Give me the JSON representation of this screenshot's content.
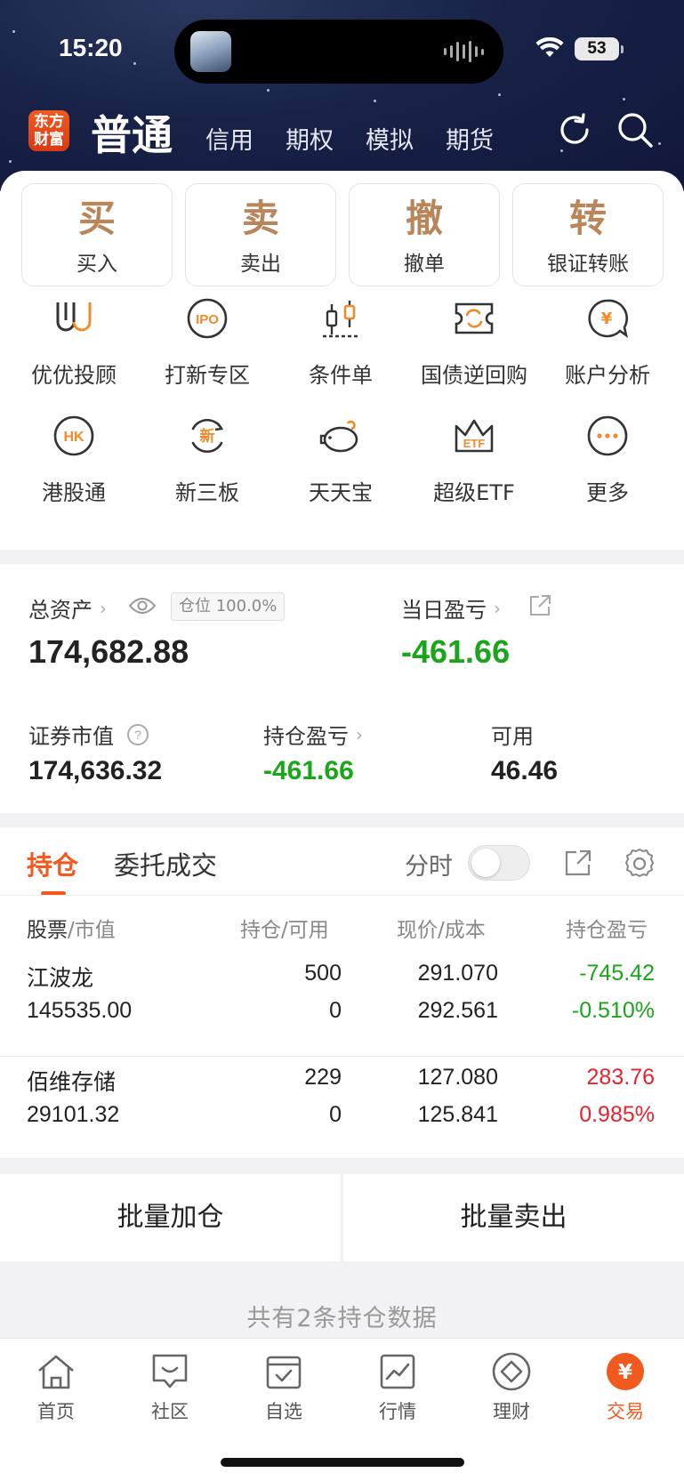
{
  "status_bar": {
    "time": "15:20",
    "battery": "53"
  },
  "header": {
    "logo": "东方\n财富",
    "active_tab": "普通",
    "tabs": [
      "信用",
      "期权",
      "模拟",
      "期货"
    ]
  },
  "trade_buttons": [
    {
      "glyph": "买",
      "label": "买入"
    },
    {
      "glyph": "卖",
      "label": "卖出"
    },
    {
      "glyph": "撤",
      "label": "撤单"
    },
    {
      "glyph": "转",
      "label": "银证转账"
    }
  ],
  "services": [
    {
      "label": "优优投顾",
      "icon": "uu-advisor-icon"
    },
    {
      "label": "打新专区",
      "icon": "ipo-icon",
      "icon_text": "IPO"
    },
    {
      "label": "条件单",
      "icon": "candlestick-icon"
    },
    {
      "label": "国债逆回购",
      "icon": "reverse-repo-icon"
    },
    {
      "label": "账户分析",
      "icon": "yuan-chat-icon",
      "icon_text": "¥"
    },
    {
      "label": "港股通",
      "icon": "hk-icon",
      "icon_text": "HK"
    },
    {
      "label": "新三板",
      "icon": "new-board-icon",
      "icon_text": "新"
    },
    {
      "label": "天天宝",
      "icon": "piggy-bank-icon"
    },
    {
      "label": "超级ETF",
      "icon": "etf-crown-icon",
      "icon_text": "ETF"
    },
    {
      "label": "更多",
      "icon": "more-dots-icon"
    }
  ],
  "assets": {
    "total_label": "总资产",
    "position_tag": "仓位 100.0%",
    "total_value": "174,682.88",
    "daily_pl_label": "当日盈亏",
    "daily_pl_value": "-461.66",
    "market_value_label": "证券市值",
    "market_value": "174,636.32",
    "holding_pl_label": "持仓盈亏",
    "holding_pl_value": "-461.66",
    "available_label": "可用",
    "available_value": "46.46"
  },
  "holdings": {
    "tab_active": "持仓",
    "tab_other": "委托成交",
    "intraday_label": "分时",
    "intraday_on": false,
    "columns": [
      "股票",
      "市值",
      "持仓",
      "可用",
      "现价",
      "成本",
      "持仓盈亏"
    ],
    "rows": [
      {
        "name": "江波龙",
        "market_value": "145535.00",
        "position": "500",
        "available": "0",
        "price": "291.070",
        "cost": "292.561",
        "pl": "-745.42",
        "pl_pct": "-0.510%",
        "trend": "down"
      },
      {
        "name": "佰维存储",
        "market_value": "29101.32",
        "position": "229",
        "available": "0",
        "price": "127.080",
        "cost": "125.841",
        "pl": "283.76",
        "pl_pct": "0.985%",
        "trend": "up"
      }
    ]
  },
  "batch": {
    "add": "批量加仓",
    "sell": "批量卖出"
  },
  "footer_count": "共有2条持仓数据",
  "bottom_nav": [
    {
      "label": "首页",
      "icon": "home-icon"
    },
    {
      "label": "社区",
      "icon": "community-icon"
    },
    {
      "label": "自选",
      "icon": "watchlist-icon"
    },
    {
      "label": "行情",
      "icon": "market-icon"
    },
    {
      "label": "理财",
      "icon": "wealth-icon"
    },
    {
      "label": "交易",
      "icon": "trade-yuan-icon",
      "icon_text": "¥",
      "active": true
    }
  ],
  "colors": {
    "accent": "#f05a1e",
    "gold": "#b8865a",
    "up": "#e8222d",
    "down": "#1aa51a"
  }
}
